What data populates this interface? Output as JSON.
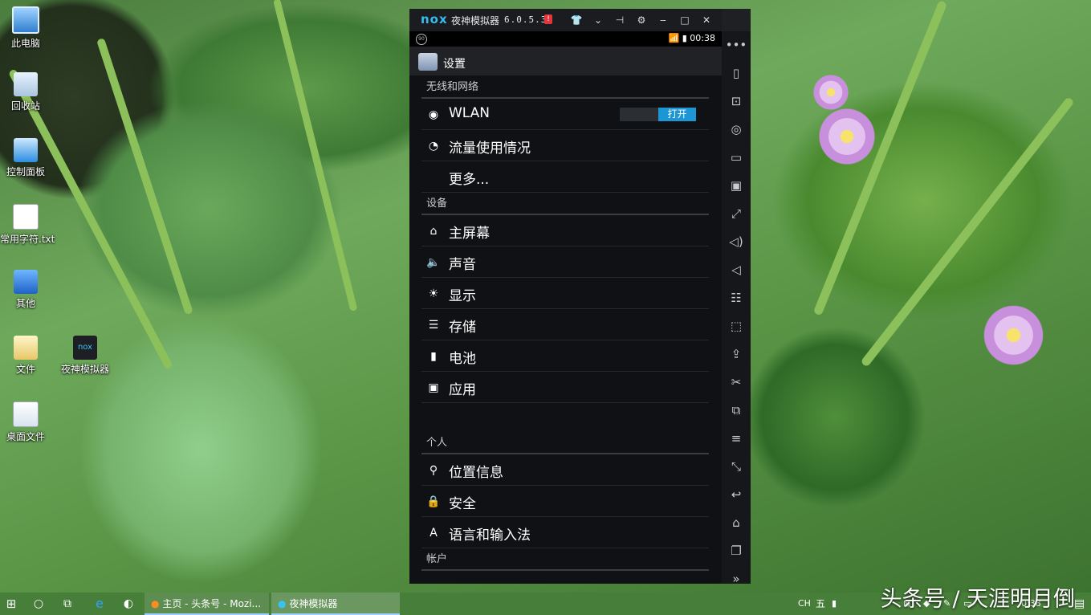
{
  "desktop": {
    "icons": [
      {
        "label": "此电脑",
        "icon": "computer-icon"
      },
      {
        "label": "回收站",
        "icon": "recycle-bin-icon"
      },
      {
        "label": "控制面板",
        "icon": "control-panel-icon"
      },
      {
        "label": "常用字符.txt",
        "icon": "text-file-icon"
      },
      {
        "label": "其他",
        "icon": "folder-icon"
      },
      {
        "label": "文件",
        "icon": "folder-icon"
      },
      {
        "label": "夜神模拟器",
        "icon": "nox-app-icon"
      },
      {
        "label": "桌面文件",
        "icon": "folder-icon"
      }
    ]
  },
  "nox": {
    "logo": "nox",
    "name": "夜神模拟器",
    "version": "6.0.5.3",
    "badge": "!",
    "controls": [
      "skin-icon",
      "dropdown-icon",
      "pin-icon",
      "settings-icon",
      "minimize-icon",
      "maximize-icon",
      "close-icon"
    ]
  },
  "android": {
    "status_time": "00:38",
    "status_left": "90",
    "app_title": "设置",
    "sections": [
      {
        "title": "无线和网络",
        "rows": [
          {
            "label": "WLAN",
            "icon": "wifi-icon",
            "toggle": "打开"
          },
          {
            "label": "流量使用情况",
            "icon": "data-usage-icon"
          },
          {
            "label": "更多...",
            "icon": ""
          }
        ]
      },
      {
        "title": "设备",
        "rows": [
          {
            "label": "主屏幕",
            "icon": "home-icon"
          },
          {
            "label": "声音",
            "icon": "sound-icon"
          },
          {
            "label": "显示",
            "icon": "display-icon"
          },
          {
            "label": "存储",
            "icon": "storage-icon"
          },
          {
            "label": "电池",
            "icon": "battery-icon"
          },
          {
            "label": "应用",
            "icon": "apps-icon"
          }
        ]
      },
      {
        "title": "个人",
        "rows": [
          {
            "label": "位置信息",
            "icon": "location-icon"
          },
          {
            "label": "安全",
            "icon": "lock-icon"
          },
          {
            "label": "语言和输入法",
            "icon": "language-icon"
          }
        ]
      },
      {
        "title": "帐户",
        "rows": []
      }
    ]
  },
  "sidebar": [
    "more-icon",
    "shake-icon",
    "robot-icon",
    "location-icon",
    "keyboard-icon",
    "screenshot-icon",
    "fullscreen-icon",
    "volume-up-icon",
    "volume-down-icon",
    "apk-install-icon",
    "mouse-control-icon",
    "file-share-icon",
    "scissors-icon",
    "multi-instance-icon",
    "menu-icon",
    "expand-icon",
    "back-icon",
    "home-icon",
    "recent-apps-icon",
    "collapse-icon"
  ],
  "taskbar": {
    "apps": [
      {
        "label": "主页 - 头条号 - Mozi..."
      },
      {
        "label": "夜神模拟器"
      }
    ],
    "tray_lang": "CH",
    "tray_ime": "五",
    "tray_time": "0:38"
  },
  "watermark": "头条号 / 天涯明月倒"
}
